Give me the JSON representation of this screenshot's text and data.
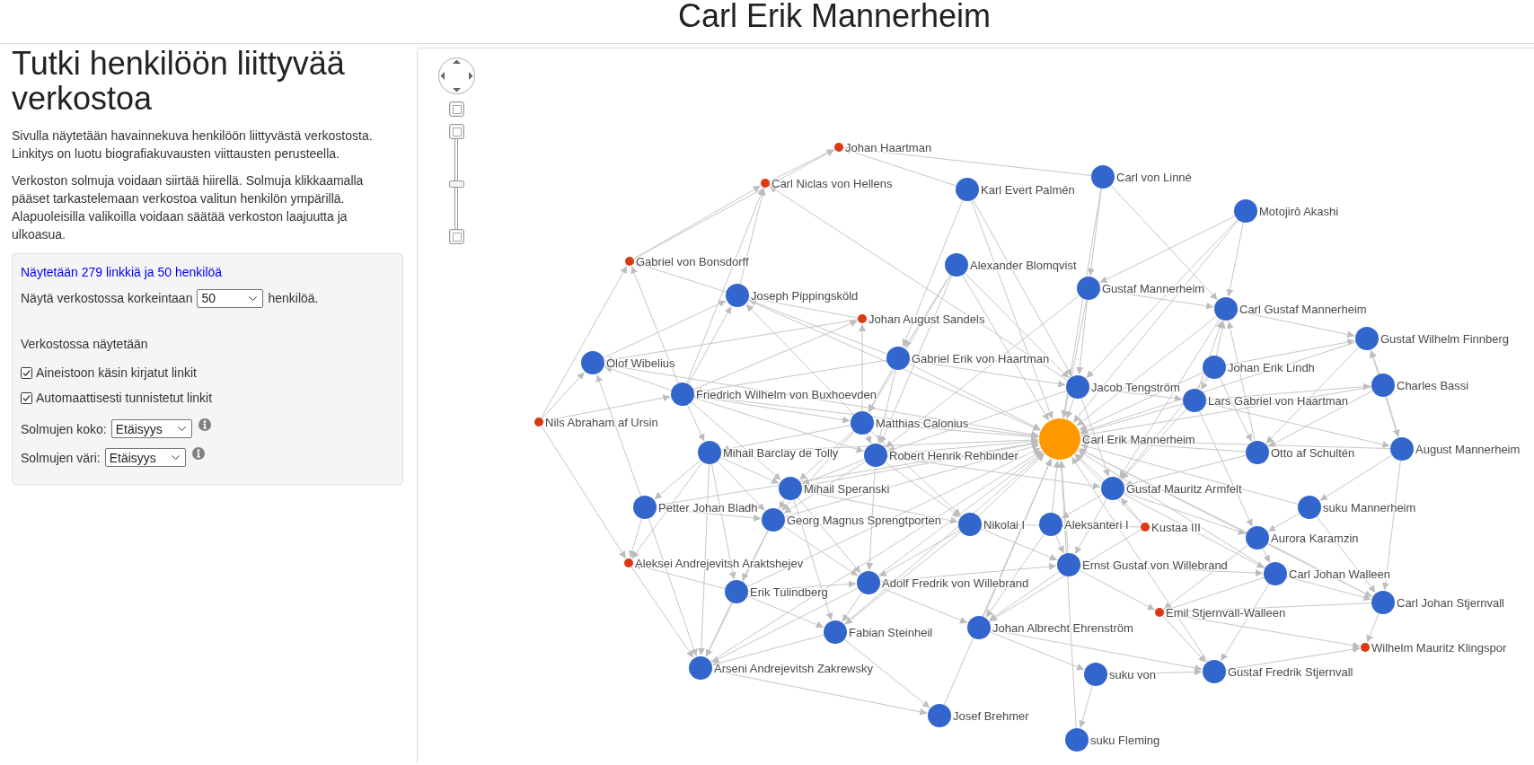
{
  "page": {
    "title": "Carl Erik Mannerheim"
  },
  "sidebar": {
    "heading": "Tutki henkilöön liittyvää verkostoa",
    "paragraphs": [
      "Sivulla näytetään havainnekuva henkilöön liittyvästä verkostosta. Linkitys on luotu biografiakuvausten viittausten perusteella.",
      "Verkoston solmuja voidaan siirtää hiirellä. Solmuja klikkaamalla pääset tarkastelemaan verkostoa valitun henkilön ympärillä. Alapuoleisilla valikoilla voidaan säätää verkoston laajuutta ja ulkoasua."
    ],
    "settings": {
      "summary": "Näytetään 279 linkkiä ja 50 henkilöä",
      "limit": {
        "label": "Näytä verkostossa korkeintaan",
        "value": "50",
        "suffix": "henkilöä."
      },
      "links_heading": "Verkostossa näytetään",
      "link_types": [
        {
          "label": "Aineistoon käsin kirjatut linkit",
          "checked": true
        },
        {
          "label": "Automaattisesti tunnistetut linkit",
          "checked": true
        }
      ],
      "selects": [
        {
          "label": "Solmujen koko:",
          "value": "Etäisyys"
        },
        {
          "label": "Solmujen väri:",
          "value": "Etäisyys"
        }
      ]
    }
  },
  "graph": {
    "zoom": {
      "level": 0.5
    },
    "nodes": [
      {
        "label": "Johan Haartman",
        "kind": "small",
        "color": "#dc3912"
      },
      {
        "label": "Carl Niclas von Hellens",
        "kind": "small",
        "color": "#dc3912"
      },
      {
        "label": "Karl Evert Palmén",
        "kind": "large",
        "color": "#3366cc"
      },
      {
        "label": "Carl von Linné",
        "kind": "large",
        "color": "#3366cc"
      },
      {
        "label": "Motojirô Akashi",
        "kind": "large",
        "color": "#3366cc"
      },
      {
        "label": "Gabriel von Bonsdorff",
        "kind": "small",
        "color": "#dc3912"
      },
      {
        "label": "Alexander Blomqvist",
        "kind": "large",
        "color": "#3366cc"
      },
      {
        "label": "Joseph Pippingsköld",
        "kind": "large",
        "color": "#3366cc"
      },
      {
        "label": "Gustaf Mannerheim",
        "kind": "large",
        "color": "#3366cc"
      },
      {
        "label": "Carl Gustaf Mannerheim",
        "kind": "large",
        "color": "#3366cc"
      },
      {
        "label": "Gustaf Wilhelm Finnberg",
        "kind": "large",
        "color": "#3366cc"
      },
      {
        "label": "Johan August Sandels",
        "kind": "small",
        "color": "#dc3912"
      },
      {
        "label": "Olof Wibelius",
        "kind": "large",
        "color": "#3366cc"
      },
      {
        "label": "Gabriel Erik von Haartman",
        "kind": "large",
        "color": "#3366cc"
      },
      {
        "label": "Friedrich Wilhelm von Buxhoevden",
        "kind": "large",
        "color": "#3366cc"
      },
      {
        "label": "Jacob Tengström",
        "kind": "large",
        "color": "#3366cc"
      },
      {
        "label": "Johan Erik Lindh",
        "kind": "large",
        "color": "#3366cc"
      },
      {
        "label": "Lars Gabriel von Haartman",
        "kind": "large",
        "color": "#3366cc"
      },
      {
        "label": "Charles Bassi",
        "kind": "large",
        "color": "#3366cc"
      },
      {
        "label": "Matthias Calonius",
        "kind": "large",
        "color": "#3366cc"
      },
      {
        "label": "Nils Abraham af Ursin",
        "kind": "small",
        "color": "#dc3912"
      },
      {
        "label": "Carl Erik Mannerheim",
        "kind": "focus",
        "color": "#ff9900"
      },
      {
        "label": "Mihail Barclay de Tolly",
        "kind": "large",
        "color": "#3366cc"
      },
      {
        "label": "Robert Henrik Rehbinder",
        "kind": "large",
        "color": "#3366cc"
      },
      {
        "label": "Otto af Schultén",
        "kind": "large",
        "color": "#3366cc"
      },
      {
        "label": "August Mannerheim",
        "kind": "large",
        "color": "#3366cc"
      },
      {
        "label": "Mihail Speranski",
        "kind": "large",
        "color": "#3366cc"
      },
      {
        "label": "Gustaf Mauritz Armfelt",
        "kind": "large",
        "color": "#3366cc"
      },
      {
        "label": "Petter Johan Bladh",
        "kind": "large",
        "color": "#3366cc"
      },
      {
        "label": "suku Mannerheim",
        "kind": "large",
        "color": "#3366cc"
      },
      {
        "label": "Georg Magnus Sprengtporten",
        "kind": "large",
        "color": "#3366cc"
      },
      {
        "label": "Nikolai I",
        "kind": "large",
        "color": "#3366cc"
      },
      {
        "label": "Aleksanteri I",
        "kind": "large",
        "color": "#3366cc"
      },
      {
        "label": "Kustaa III",
        "kind": "small",
        "color": "#dc3912"
      },
      {
        "label": "Aurora Karamzin",
        "kind": "large",
        "color": "#3366cc"
      },
      {
        "label": "Aleksei Andrejevitsh Araktshejev",
        "kind": "small",
        "color": "#dc3912"
      },
      {
        "label": "Erik Tulindberg",
        "kind": "large",
        "color": "#3366cc"
      },
      {
        "label": "Adolf Fredrik von Willebrand",
        "kind": "large",
        "color": "#3366cc"
      },
      {
        "label": "Ernst Gustaf von Willebrand",
        "kind": "large",
        "color": "#3366cc"
      },
      {
        "label": "Carl Johan Walleen",
        "kind": "large",
        "color": "#3366cc"
      },
      {
        "label": "Carl Johan Stjernvall",
        "kind": "large",
        "color": "#3366cc"
      },
      {
        "label": "Emil Stjernvall-Walleen",
        "kind": "small",
        "color": "#dc3912"
      },
      {
        "label": "Johan Albrecht Ehrenström",
        "kind": "large",
        "color": "#3366cc"
      },
      {
        "label": "Fabian Steinheil",
        "kind": "large",
        "color": "#3366cc"
      },
      {
        "label": "Arseni Andrejevitsh Zakrewsky",
        "kind": "large",
        "color": "#3366cc"
      },
      {
        "label": "suku von",
        "kind": "large",
        "color": "#3366cc"
      },
      {
        "label": "Gustaf Fredrik Stjernvall",
        "kind": "large",
        "color": "#3366cc"
      },
      {
        "label": "Wilhelm Mauritz Klingspor",
        "kind": "small",
        "color": "#dc3912"
      },
      {
        "label": "Josef Brehmer",
        "kind": "large",
        "color": "#3366cc"
      },
      {
        "label": "suku Fleming",
        "kind": "large",
        "color": "#3366cc"
      }
    ]
  }
}
